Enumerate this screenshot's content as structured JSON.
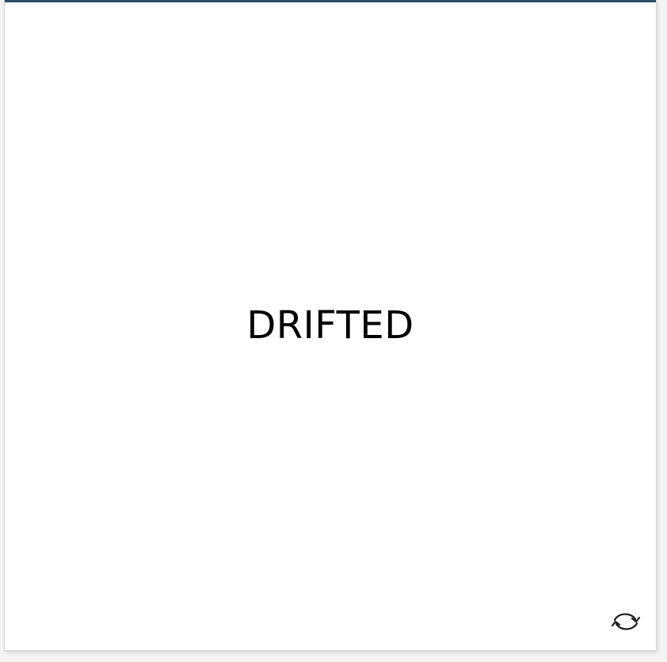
{
  "status": {
    "text": "DRIFTED"
  },
  "refresh_button": {
    "icon": "refresh-icon"
  },
  "colors": {
    "accent": "#2d4e68",
    "card_background": "#ffffff",
    "page_background": "#f3f3f3"
  }
}
